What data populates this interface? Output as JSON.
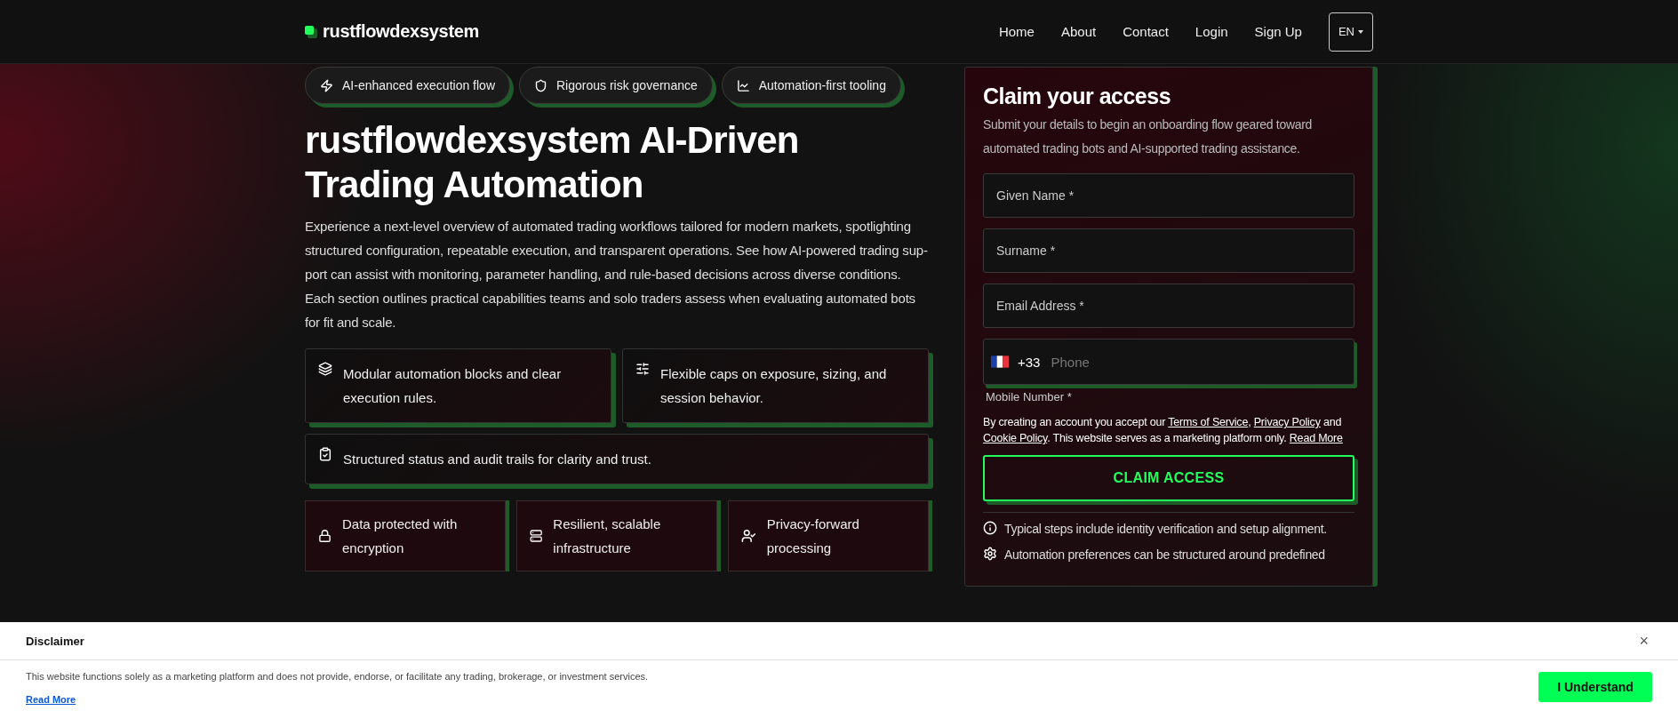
{
  "header": {
    "logo": "rustflowdexsystem",
    "nav": [
      {
        "label": "Home"
      },
      {
        "label": "About"
      },
      {
        "label": "Contact"
      },
      {
        "label": "Login"
      },
      {
        "label": "Sign Up"
      }
    ],
    "language": "EN"
  },
  "badges": [
    {
      "label": "AI-enhanced execution flow"
    },
    {
      "label": "Rigorous risk governance"
    },
    {
      "label": "Automation-first tooling"
    }
  ],
  "hero": {
    "title_line_1": "rustflowdexsystem AI-Driven",
    "title_line_2": "Trading Automation",
    "description": "Experience a next-level overview of automated trading workflows tailored for modern markets, spotlighting structured configuration, repeatable execution, and transparent operations. See how AI-powered trading sup-port can assist with monitoring, parameter handling, and rule-based decisions across diverse conditions. Each section outlines practical capabilities teams and solo traders assess when evaluating automated bots for fit and scale."
  },
  "features": [
    {
      "text": "Modular automation blocks and clear execution rules."
    },
    {
      "text": "Flexible caps on exposure, sizing, and session behavior."
    },
    {
      "text": "Structured status and audit trails for clarity and trust."
    }
  ],
  "trust_items": [
    {
      "text": "Data protected with encryption"
    },
    {
      "text": "Resilient, scalable infrastructure"
    },
    {
      "text": "Privacy-forward processing"
    }
  ],
  "form": {
    "title": "Claim your access",
    "subtitle": "Submit your details to begin an onboarding flow geared toward automated trading bots and AI-supported trading assistance.",
    "fields": [
      {
        "placeholder": "Given Name *"
      },
      {
        "placeholder": "Surname *"
      },
      {
        "placeholder": "Email Address *"
      }
    ],
    "phone": {
      "dial_code": "+33",
      "placeholder": "Phone",
      "label": "Mobile Number *"
    },
    "consent": [
      {
        "kind": "text",
        "text": "By creating an account you accept our "
      },
      {
        "kind": "link",
        "text": "Terms of Service"
      },
      {
        "kind": "text",
        "text": ", "
      },
      {
        "kind": "link",
        "text": "Privacy Policy"
      },
      {
        "kind": "text",
        "text": " and "
      },
      {
        "kind": "link",
        "text": "Cookie Policy"
      },
      {
        "kind": "text",
        "text": ". This website serves as a marketing platform only. "
      },
      {
        "kind": "link",
        "text": "Read More"
      }
    ],
    "submit": "CLAIM ACCESS",
    "notes": [
      {
        "text": "Typical steps include identity verification and setup alignment."
      },
      {
        "text": "Automation preferences can be structured around predefined"
      }
    ]
  },
  "disclaimer": {
    "title": "Disclaimer",
    "close": "×",
    "text": "This website functions solely as a marketing platform and does not provide, endorse, or facilitate any trading, brokerage, or investment services.",
    "link": "Read More",
    "button": "I Understand"
  }
}
